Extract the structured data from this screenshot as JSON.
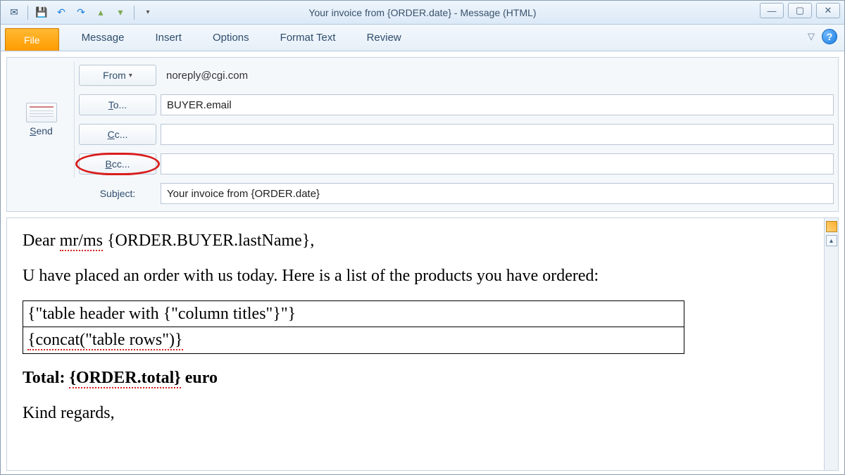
{
  "window": {
    "title": "Your invoice from {ORDER.date}  -  Message (HTML)"
  },
  "qat": {
    "items": [
      "reply-icon",
      "save-icon",
      "undo-icon",
      "redo-icon",
      "prev-icon",
      "next-icon"
    ]
  },
  "win": {
    "min": "—",
    "max": "▢",
    "close": "✕"
  },
  "ribbon": {
    "file": "File",
    "tabs": [
      "Message",
      "Insert",
      "Options",
      "Format Text",
      "Review"
    ],
    "collapse": "▽",
    "help": "?"
  },
  "compose": {
    "send": "Send",
    "from_label": "From",
    "from_value": "noreply@cgi.com",
    "to_label": "To...",
    "to_value": "BUYER.email",
    "cc_label": "Cc...",
    "cc_value": "",
    "bcc_label": "Bcc...",
    "bcc_value": "",
    "subject_label": "Subject:",
    "subject_value": "Your invoice from {ORDER.date}"
  },
  "body": {
    "greeting_prefix": "Dear ",
    "greeting_salutation": "mr/ms",
    "greeting_tpl": " {ORDER.BUYER.lastName},",
    "para_intro": "U have placed an order with us today. Here is a list of the products you have ordered:",
    "tbl_row1": "{\"table header with {\"column titles\"}\"}",
    "tbl_row2": "{concat(\"table rows\")}",
    "total_prefix": "Total: ",
    "total_tpl": "{ORDER.total}",
    "total_suffix": " euro",
    "signoff": "Kind regards,"
  }
}
